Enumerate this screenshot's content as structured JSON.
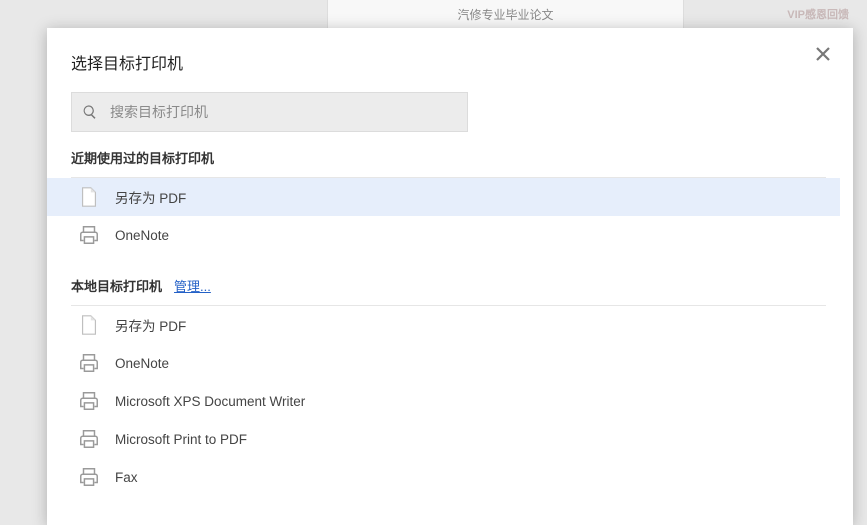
{
  "background": {
    "doc_title": "汽修专业毕业论文",
    "vip_text": "VIP感恩回馈"
  },
  "dialog": {
    "title": "选择目标打印机",
    "search_placeholder": "搜索目标打印机",
    "recent_header": "近期使用过的目标打印机",
    "local_header": "本地目标打印机",
    "manage_label": "管理...",
    "recent": [
      {
        "label": "另存为 PDF",
        "icon": "pdf",
        "selected": true
      },
      {
        "label": "OneNote",
        "icon": "printer",
        "selected": false
      }
    ],
    "local": [
      {
        "label": "另存为 PDF",
        "icon": "pdf"
      },
      {
        "label": "OneNote",
        "icon": "printer"
      },
      {
        "label": "Microsoft XPS Document Writer",
        "icon": "printer"
      },
      {
        "label": "Microsoft Print to PDF",
        "icon": "printer"
      },
      {
        "label": "Fax",
        "icon": "printer"
      }
    ]
  }
}
